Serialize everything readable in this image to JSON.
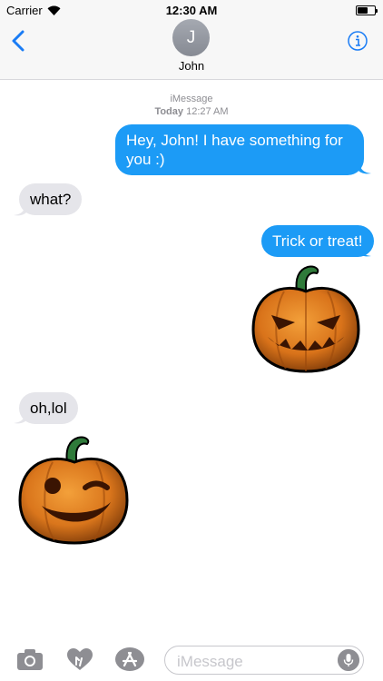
{
  "status_bar": {
    "carrier": "Carrier",
    "time": "12:30 AM"
  },
  "header": {
    "avatar_initial": "J",
    "contact_name": "John",
    "back_icon": "chevron-left-icon",
    "info_icon": "info-circle-icon"
  },
  "conversation": {
    "service": "iMessage",
    "day": "Today",
    "time": "12:27 AM",
    "messages": [
      {
        "from": "me",
        "kind": "text",
        "text": "Hey, John! I have something for you :)"
      },
      {
        "from": "them",
        "kind": "text",
        "text": "what?"
      },
      {
        "from": "me",
        "kind": "text",
        "text": "Trick or treat!"
      },
      {
        "from": "me",
        "kind": "sticker",
        "sticker": "angry-jack-o-lantern"
      },
      {
        "from": "them",
        "kind": "text",
        "text": "oh,lol"
      },
      {
        "from": "them",
        "kind": "sticker",
        "sticker": "winking-jack-o-lantern"
      }
    ]
  },
  "input_bar": {
    "placeholder": "iMessage",
    "icons": [
      "camera-icon",
      "digital-touch-heart-icon",
      "app-store-icon",
      "microphone-icon"
    ]
  },
  "colors": {
    "outgoing_bubble": "#1c9bf6",
    "incoming_bubble": "#e5e5ea",
    "accent": "#1a7cf5"
  }
}
